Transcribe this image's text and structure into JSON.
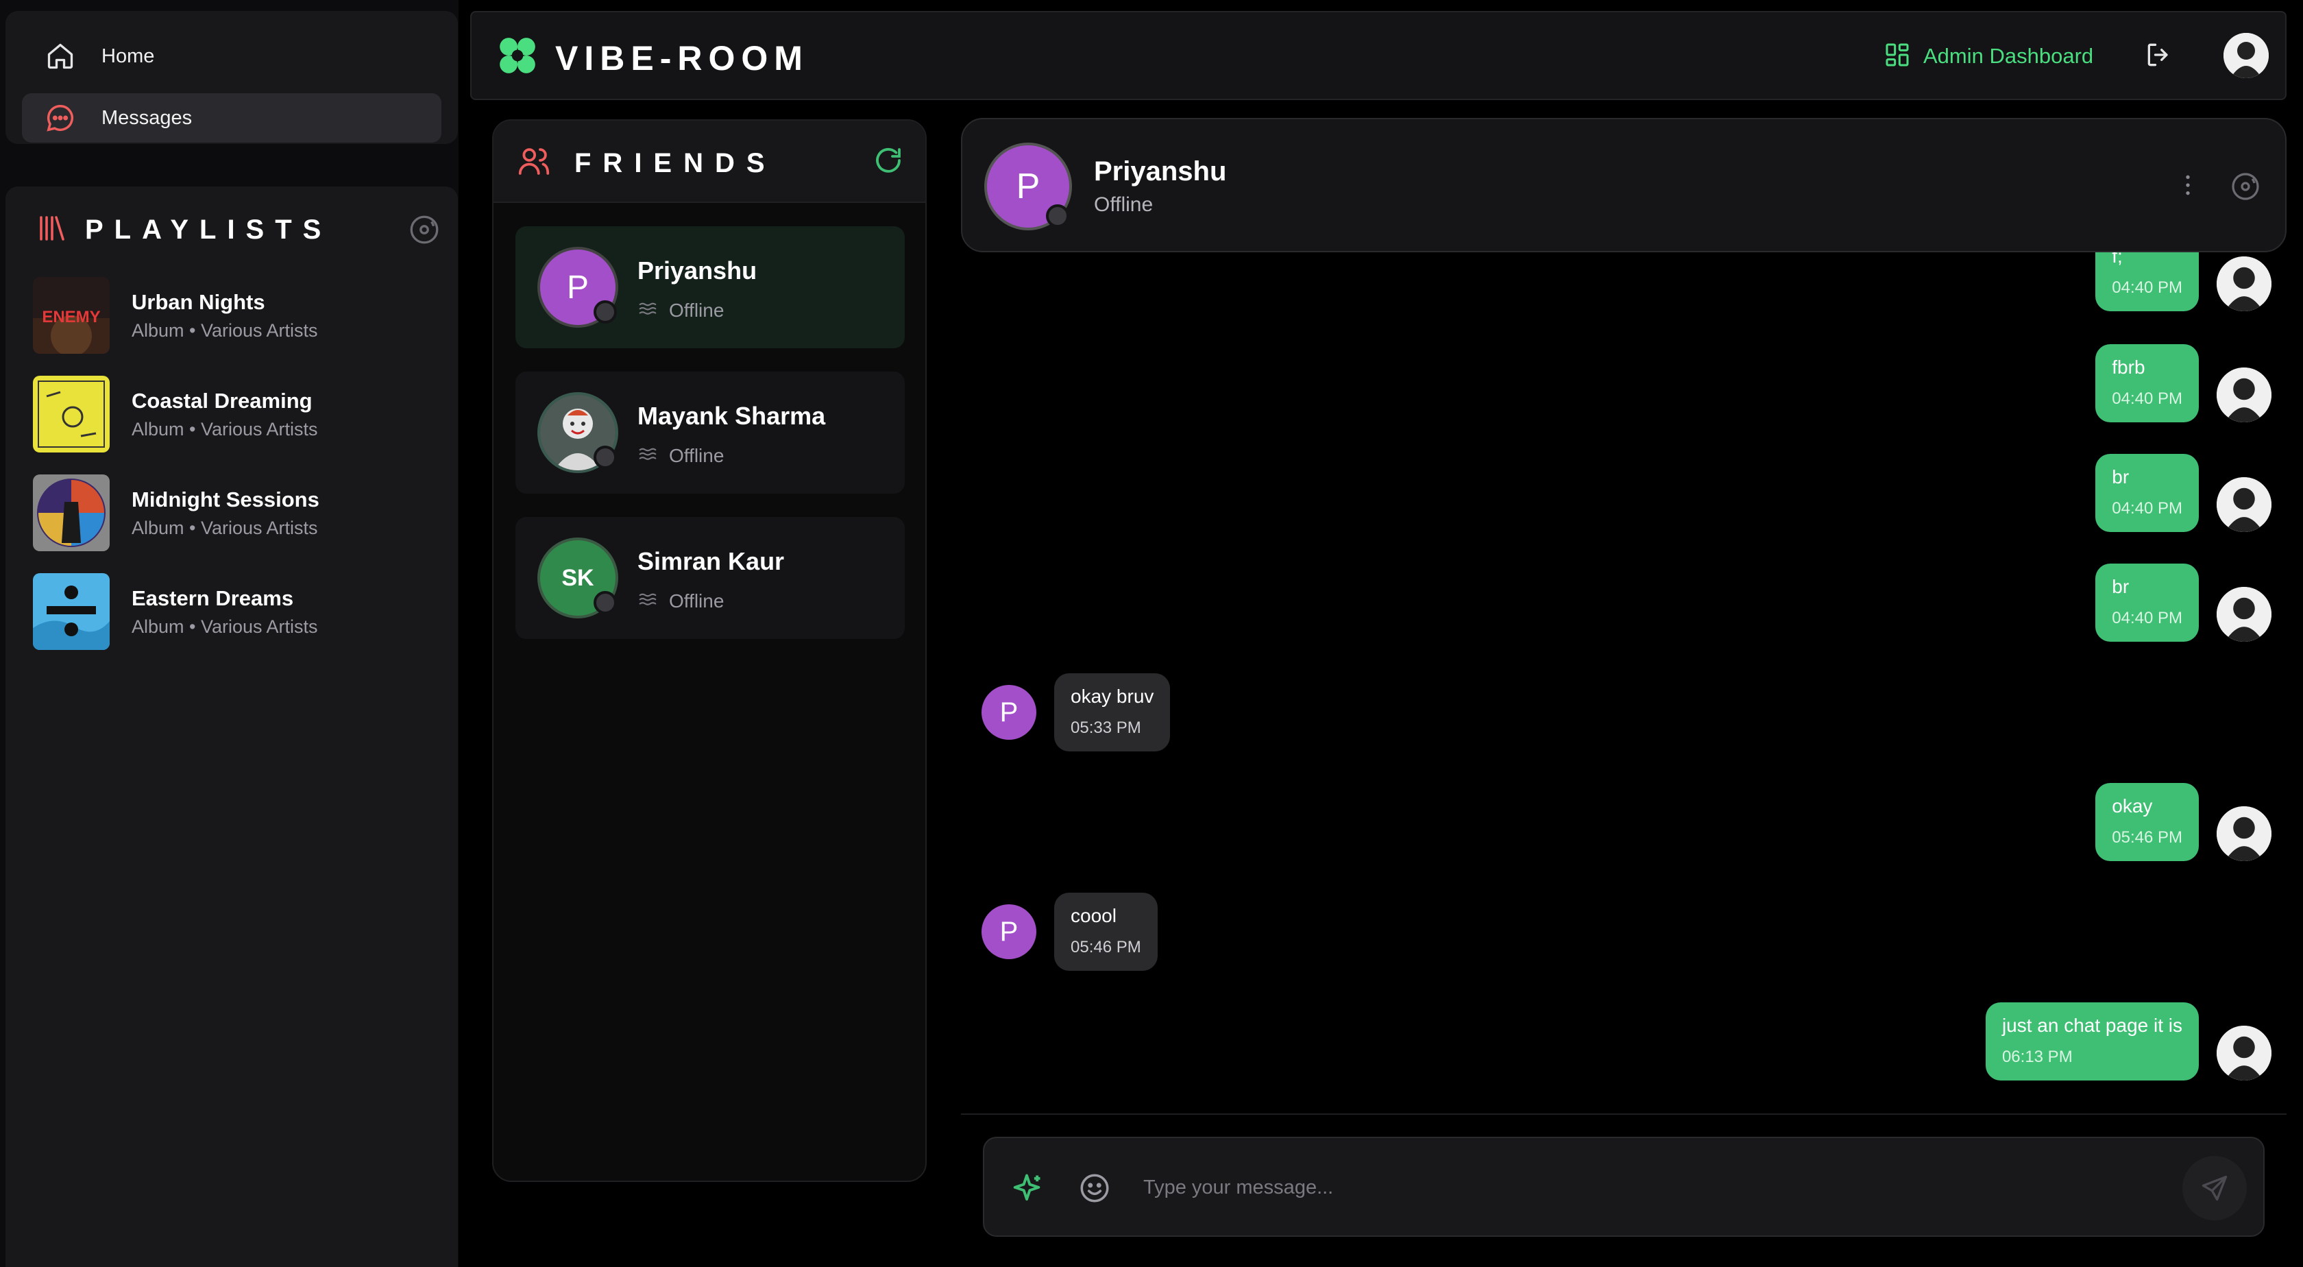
{
  "sidebar": {
    "nav": [
      {
        "label": "Home",
        "icon": "home-icon"
      },
      {
        "label": "Messages",
        "icon": "message-icon"
      }
    ],
    "playlists_title": "PLAYLISTS",
    "playlists": [
      {
        "name": "Urban Nights",
        "subtitle": "Album • Various Artists",
        "art_text": "ENEMY"
      },
      {
        "name": "Coastal Dreaming",
        "subtitle": "Album • Various Artists"
      },
      {
        "name": "Midnight Sessions",
        "subtitle": "Album • Various Artists"
      },
      {
        "name": "Eastern Dreams",
        "subtitle": "Album • Various Artists"
      }
    ]
  },
  "header": {
    "brand": "VIBE-ROOM",
    "admin_label": "Admin Dashboard",
    "accent": "#4ade80"
  },
  "friends": {
    "title": "FRIENDS",
    "items": [
      {
        "name": "Priyanshu",
        "status": "Offline",
        "initials": "P",
        "avatar_color": "#a34fc9"
      },
      {
        "name": "Mayank Sharma",
        "status": "Offline"
      },
      {
        "name": "Simran Kaur",
        "status": "Offline",
        "initials": "SK",
        "avatar_color": "#2f8a4c"
      }
    ]
  },
  "chat": {
    "name": "Priyanshu",
    "status": "Offline",
    "initial": "P",
    "messages": [
      {
        "dir": "out",
        "text": "f;",
        "time": "04:40 PM"
      },
      {
        "dir": "out",
        "text": "fbrb",
        "time": "04:40 PM"
      },
      {
        "dir": "out",
        "text": "br",
        "time": "04:40 PM"
      },
      {
        "dir": "out",
        "text": "br",
        "time": "04:40 PM"
      },
      {
        "dir": "in",
        "text": "okay bruv",
        "time": "05:33 PM"
      },
      {
        "dir": "out",
        "text": "okay",
        "time": "05:46 PM"
      },
      {
        "dir": "in",
        "text": "coool",
        "time": "05:46 PM"
      },
      {
        "dir": "out",
        "text": "just an chat page it is",
        "time": "06:13 PM"
      }
    ]
  },
  "composer": {
    "placeholder": "Type your message..."
  }
}
